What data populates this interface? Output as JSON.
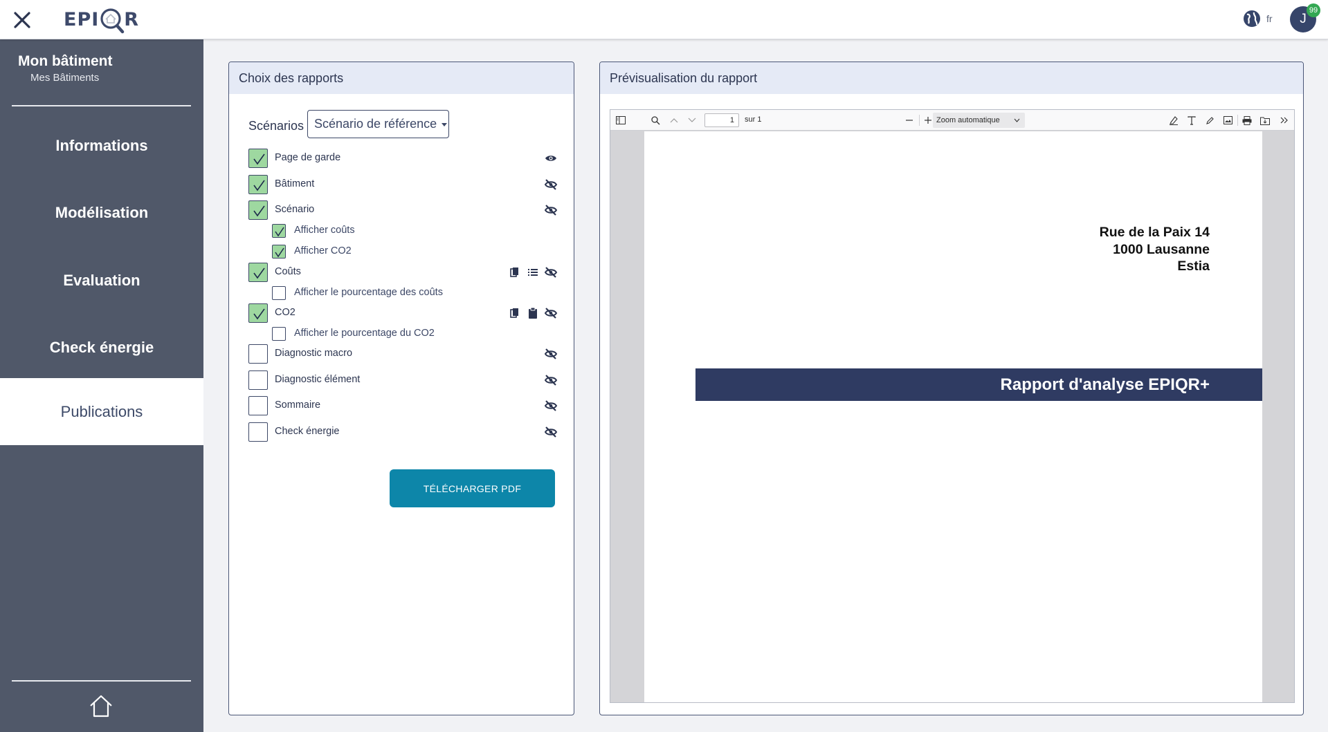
{
  "header": {
    "logo_text_left": "EPI",
    "logo_text_right": "R",
    "language": "fr",
    "user_initial": "J",
    "notification_count": "99"
  },
  "sidebar": {
    "building_title": "Mon bâtiment",
    "building_subtitle": "Mes Bâtiments",
    "items": [
      {
        "label": "Informations"
      },
      {
        "label": "Modélisation"
      },
      {
        "label": "Evaluation"
      },
      {
        "label": "Check énergie"
      },
      {
        "label": "Publications",
        "active": true
      }
    ]
  },
  "report_choice": {
    "title": "Choix des rapports",
    "scenarios_label": "Scénarios",
    "scenario_selected": "Scénario de référence",
    "options": [
      {
        "label": "Page de garde",
        "checked": true,
        "icons": [
          "eye-icon"
        ]
      },
      {
        "label": "Bâtiment",
        "checked": true,
        "icons": [
          "eye-off-icon"
        ]
      },
      {
        "label": "Scénario",
        "checked": true,
        "icons": [
          "eye-off-icon"
        ]
      },
      {
        "label": "Afficher coûts",
        "checked": true,
        "sub": true
      },
      {
        "label": "Afficher CO2",
        "checked": true,
        "sub": true
      },
      {
        "label": "Coûts",
        "checked": true,
        "icons": [
          "copy-icon",
          "list-icon",
          "eye-off-icon"
        ]
      },
      {
        "label": "Afficher le pourcentage des coûts",
        "checked": false,
        "sub": true
      },
      {
        "label": "CO2",
        "checked": true,
        "icons": [
          "copy-icon",
          "clipboard-icon",
          "eye-off-icon"
        ]
      },
      {
        "label": "Afficher le pourcentage du CO2",
        "checked": false,
        "sub": true
      },
      {
        "label": "Diagnostic macro",
        "checked": false,
        "icons": [
          "eye-off-icon"
        ]
      },
      {
        "label": "Diagnostic élément",
        "checked": false,
        "icons": [
          "eye-off-icon"
        ]
      },
      {
        "label": "Sommaire",
        "checked": false,
        "icons": [
          "eye-off-icon"
        ]
      },
      {
        "label": "Check énergie",
        "checked": false,
        "icons": [
          "eye-off-icon"
        ]
      }
    ],
    "download_label": "TÉLÉCHARGER PDF"
  },
  "preview": {
    "title": "Prévisualisation du rapport",
    "toolbar": {
      "page_number": "1",
      "page_of": "sur 1",
      "zoom": "Zoom automatique"
    },
    "document": {
      "address_lines": [
        "Rue de la Paix 14",
        "1000 Lausanne",
        "Estia"
      ],
      "banner": "Rapport d'analyse EPIQR+"
    }
  },
  "colors": {
    "sidebar_bg": "#505869",
    "panel_border": "#4a5676",
    "panel_header_bg": "#e5eaf6",
    "checkbox_checked": "#9ed8a0",
    "download_button": "#0d86a9",
    "banner_bg": "#2f3b62"
  }
}
